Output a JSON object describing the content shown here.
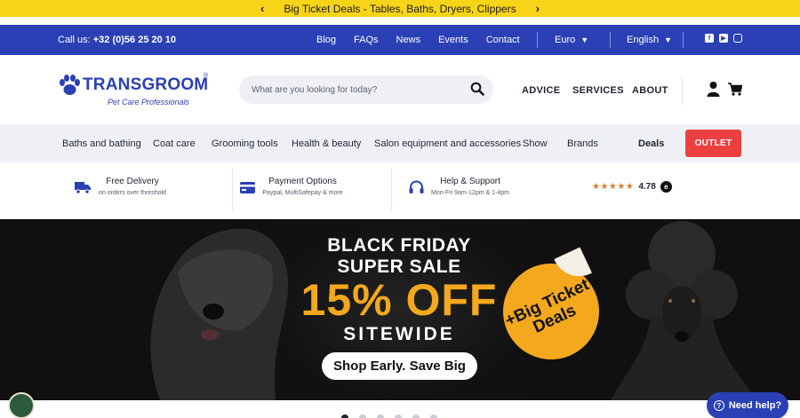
{
  "promo": {
    "text": "Big Ticket Deals - Tables, Baths, Dryers, Clippers",
    "prev": "‹",
    "next": "›"
  },
  "topbar": {
    "call_label": "Call us:",
    "phone": "+32 (0)56 25 20 10",
    "links": [
      "Blog",
      "FAQs",
      "News",
      "Events",
      "Contact"
    ],
    "currency": "Euro",
    "language": "English",
    "social": [
      "facebook-icon",
      "youtube-icon",
      "instagram-icon"
    ]
  },
  "header": {
    "brand": "TRANSGROOM",
    "registered": "®",
    "tagline": "Pet Care Professionals",
    "search_placeholder": "What are you looking for today?",
    "nav": [
      "ADVICE",
      "SERVICES",
      "ABOUT"
    ]
  },
  "categories": [
    "Baths and bathing",
    "Coat care",
    "Grooming tools",
    "Health & beauty",
    "Salon equipment and accessories",
    "Show",
    "Brands",
    "Deals"
  ],
  "outlet": "OUTLET",
  "usp": [
    {
      "title": "Free Delivery",
      "sub": "on orders over threshold",
      "icon": "truck-icon"
    },
    {
      "title": "Payment Options",
      "sub": "Paypal, MultiSafepay & more",
      "icon": "card-icon"
    },
    {
      "title": "Help & Support",
      "sub": "Mon-Fri 9am-12pm & 1-4pm",
      "icon": "headset-icon"
    }
  ],
  "rating": {
    "value": "4.78",
    "stars": 4.78,
    "max_stars": 5,
    "badge": "e"
  },
  "hero": {
    "line1": "BLACK FRIDAY",
    "line2": "SUPER SALE",
    "discount": "15% OFF",
    "sitewide": "SITEWIDE",
    "cta": "Shop Early. Save Big",
    "sticker": "+Big Ticket Deals"
  },
  "carousel": {
    "slides": 6,
    "active": 1
  },
  "help_button": "Need help?",
  "colors": {
    "brand_blue": "#2a40b4",
    "promo_yellow": "#f7d417",
    "outlet_red": "#ec3f3f",
    "accent_orange": "#f3a81d"
  }
}
